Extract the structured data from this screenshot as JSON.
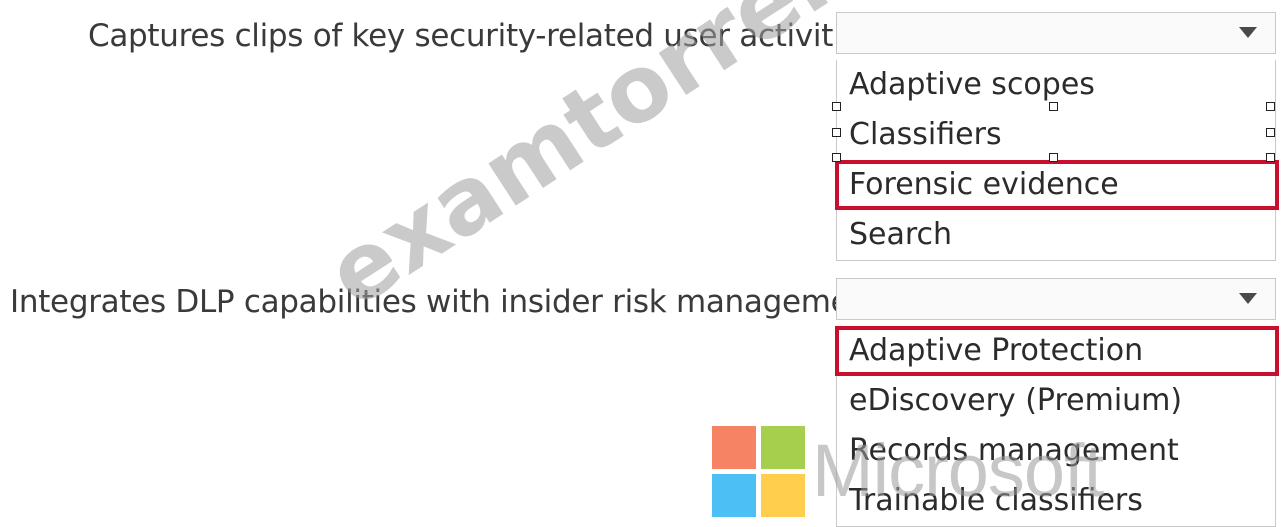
{
  "questions": [
    {
      "label": "Captures clips of key security-related user activities:",
      "options": [
        "Adaptive scopes",
        "Classifiers",
        "Forensic evidence",
        "Search"
      ],
      "selected": "Forensic evidence"
    },
    {
      "label": "Integrates DLP capabilities with insider risk management:",
      "options": [
        "Adaptive Protection",
        "eDiscovery (Premium)",
        "Records management",
        "Trainable classifiers"
      ],
      "selected": "Adaptive Protection"
    }
  ],
  "watermark": "examtorrent.com",
  "brand": {
    "name": "Microsoft",
    "colors": {
      "red": "#f25022",
      "green": "#7fba00",
      "blue": "#00a4ef",
      "yellow": "#ffb900"
    }
  },
  "accent_color": "#c8102e"
}
